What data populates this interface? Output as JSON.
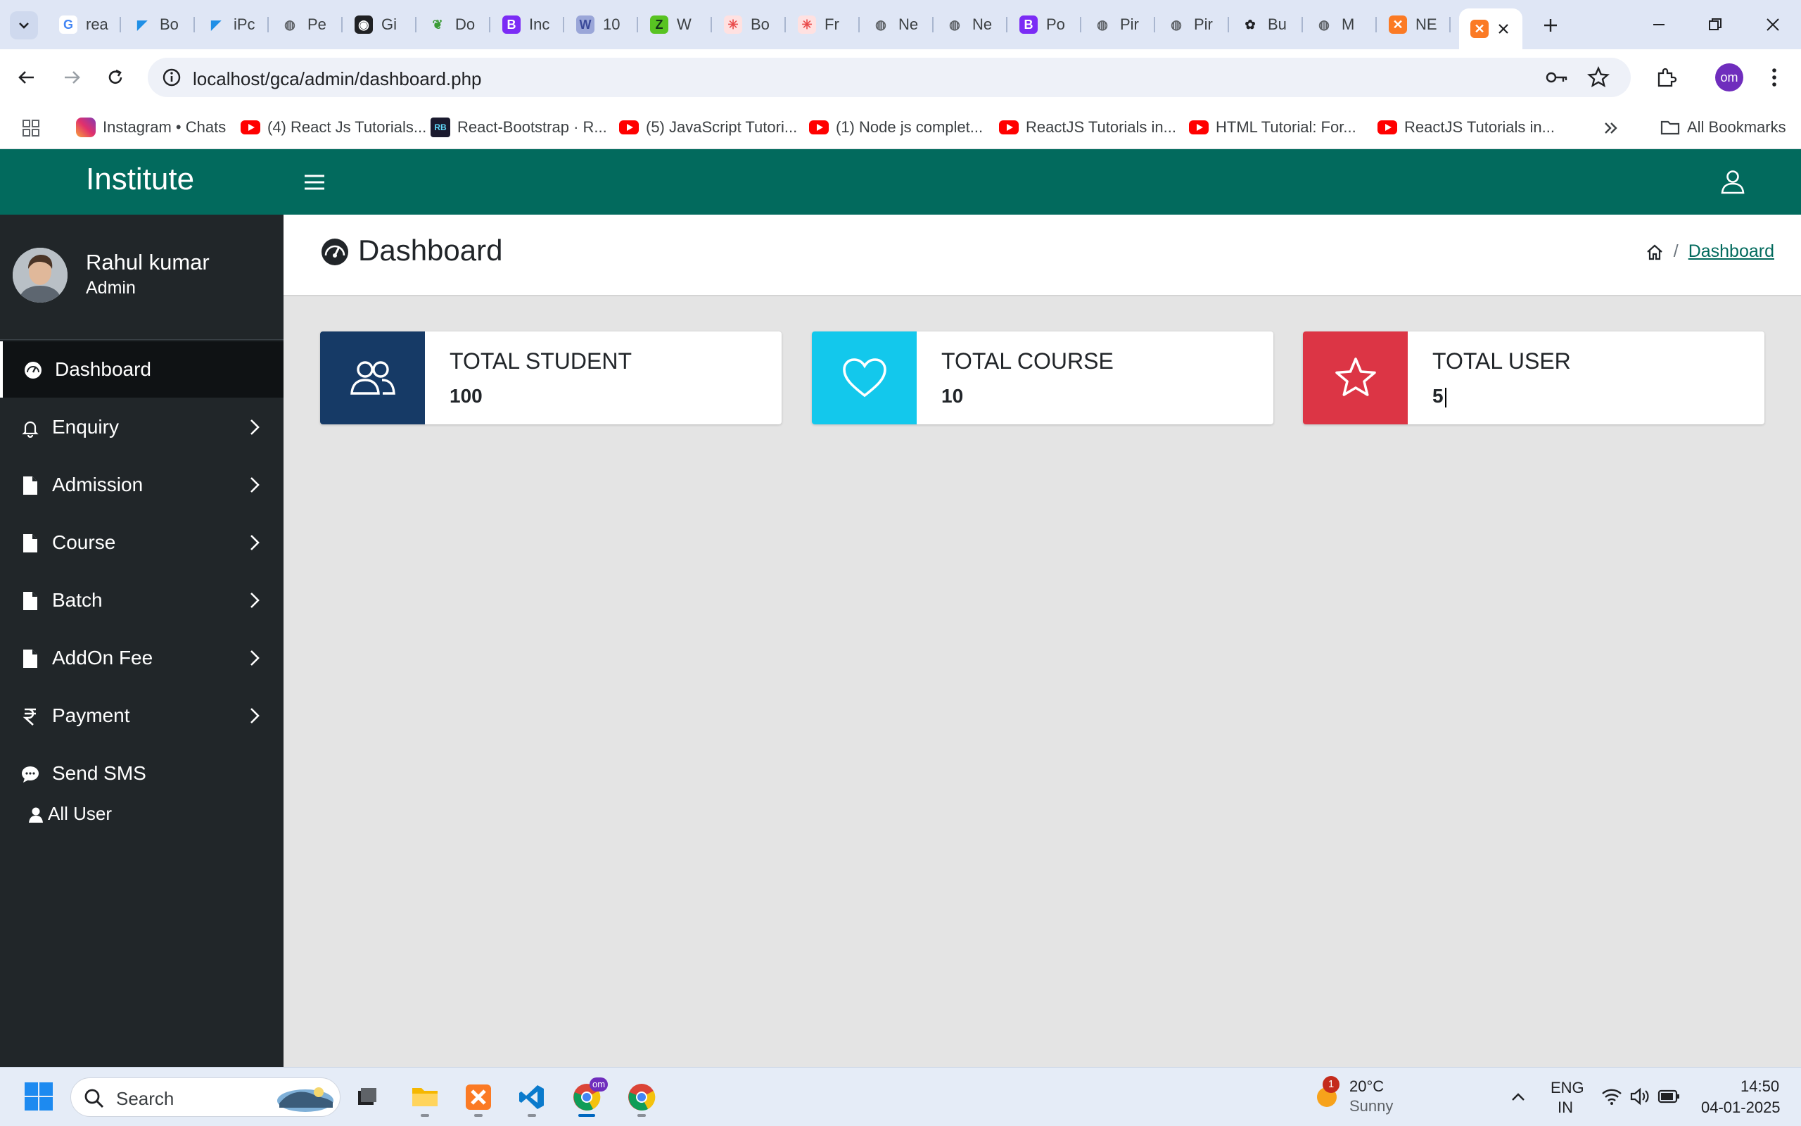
{
  "browser": {
    "tabs": [
      {
        "title": "rea",
        "favicon": "google-icon"
      },
      {
        "title": "Bo",
        "favicon": "flutter-icon"
      },
      {
        "title": "iPc",
        "favicon": "flutter-icon"
      },
      {
        "title": "Pe",
        "favicon": "globe-icon"
      },
      {
        "title": "Gi",
        "favicon": "github-icon"
      },
      {
        "title": "Do",
        "favicon": "leaf-icon"
      },
      {
        "title": "Inc",
        "favicon": "bootstrap-icon"
      },
      {
        "title": "10",
        "favicon": "wp-icon"
      },
      {
        "title": "W",
        "favicon": "green-icon"
      },
      {
        "title": "Bo",
        "favicon": "redbox-icon"
      },
      {
        "title": "Fr",
        "favicon": "redbox-icon"
      },
      {
        "title": "Ne",
        "favicon": "globe-icon"
      },
      {
        "title": "Ne",
        "favicon": "globe-icon"
      },
      {
        "title": "Po",
        "favicon": "bootstrap-icon"
      },
      {
        "title": "Pir",
        "favicon": "globe-icon"
      },
      {
        "title": "Pir",
        "favicon": "globe-icon"
      },
      {
        "title": "Bu",
        "favicon": "openai-icon"
      },
      {
        "title": "M",
        "favicon": "globe-icon"
      },
      {
        "title": "NE",
        "favicon": "xampp-icon"
      }
    ],
    "active_tab_favicon": "xampp-icon",
    "url": "localhost/gca/admin/dashboard.php",
    "profile_initials": "om",
    "bookmarks": [
      {
        "label": "Instagram • Chats",
        "icon": "instagram-icon"
      },
      {
        "label": "(4) React Js Tutorials...",
        "icon": "youtube-icon"
      },
      {
        "label": "React-Bootstrap · R...",
        "icon": "react-bootstrap-icon"
      },
      {
        "label": "(5) JavaScript Tutori...",
        "icon": "youtube-icon"
      },
      {
        "label": "(1) Node js complet...",
        "icon": "youtube-icon"
      },
      {
        "label": "ReactJS Tutorials in...",
        "icon": "youtube-icon"
      },
      {
        "label": "HTML Tutorial: For...",
        "icon": "youtube-icon"
      },
      {
        "label": "ReactJS Tutorials in...",
        "icon": "youtube-icon"
      }
    ],
    "all_bookmarks_label": "All Bookmarks"
  },
  "app": {
    "brand": "Institute",
    "theme_color": "#026a5d",
    "user": {
      "name": "Rahul kumar",
      "role": "Admin"
    },
    "nav": [
      {
        "label": "Dashboard",
        "icon": "gauge-icon",
        "active": true,
        "has_submenu": false
      },
      {
        "label": "Enquiry",
        "icon": "bell-icon",
        "active": false,
        "has_submenu": true
      },
      {
        "label": "Admission",
        "icon": "file-icon",
        "active": false,
        "has_submenu": true
      },
      {
        "label": "Course",
        "icon": "file-icon",
        "active": false,
        "has_submenu": true
      },
      {
        "label": "Batch",
        "icon": "file-icon",
        "active": false,
        "has_submenu": true
      },
      {
        "label": "AddOn Fee",
        "icon": "file-icon",
        "active": false,
        "has_submenu": true
      },
      {
        "label": "Payment",
        "icon": "rupee-icon",
        "active": false,
        "has_submenu": true
      },
      {
        "label": "Send SMS",
        "icon": "chat-icon",
        "active": false,
        "has_submenu": false
      },
      {
        "label": "All User",
        "icon": "user-icon",
        "active": false,
        "has_submenu": false
      }
    ],
    "page_title": "Dashboard",
    "breadcrumb": {
      "current": "Dashboard"
    },
    "info_boxes": [
      {
        "label": "TOTAL STUDENT",
        "value": "100",
        "color": "#163a66",
        "icon": "people-icon"
      },
      {
        "label": "TOTAL COURSE",
        "value": "10",
        "color": "#13c8ec",
        "icon": "heart-icon"
      },
      {
        "label": "TOTAL USER",
        "value": "5",
        "color": "#dc3545",
        "icon": "star-icon"
      }
    ]
  },
  "taskbar": {
    "search_placeholder": "Search",
    "weather": {
      "temp": "20°C",
      "condition": "Sunny",
      "badge": "1"
    },
    "lang_line1": "ENG",
    "lang_line2": "IN",
    "time": "14:50",
    "date": "04-01-2025"
  }
}
